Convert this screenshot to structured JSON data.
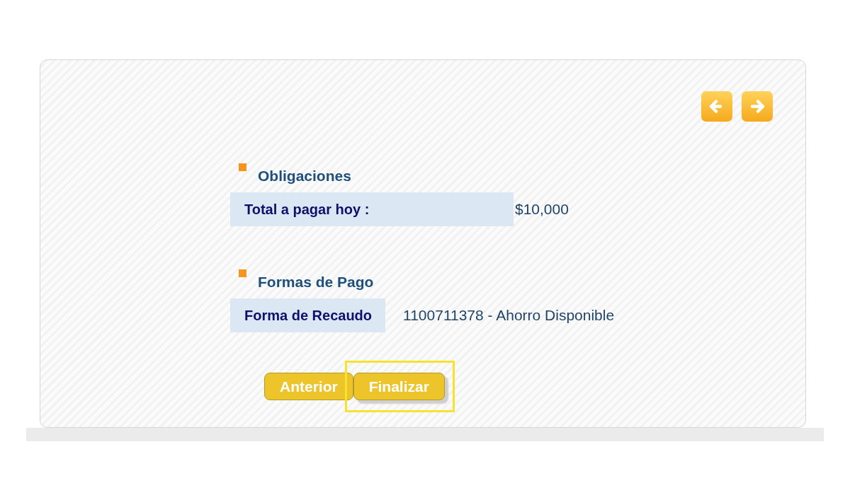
{
  "sections": [
    {
      "kind": "summary",
      "title": "Obligaciones",
      "rows": [
        {
          "label": "Total a pagar hoy :",
          "value": "$10,000"
        }
      ]
    },
    {
      "kind": "payment",
      "title": "Formas de Pago",
      "rows": [
        {
          "label": "Forma de Recaudo",
          "value": "1100711378 - Ahorro Disponible"
        }
      ]
    }
  ],
  "buttons": [
    {
      "label": "Anterior",
      "highlighted": false
    },
    {
      "label": "Finalizar",
      "highlighted": true
    }
  ]
}
